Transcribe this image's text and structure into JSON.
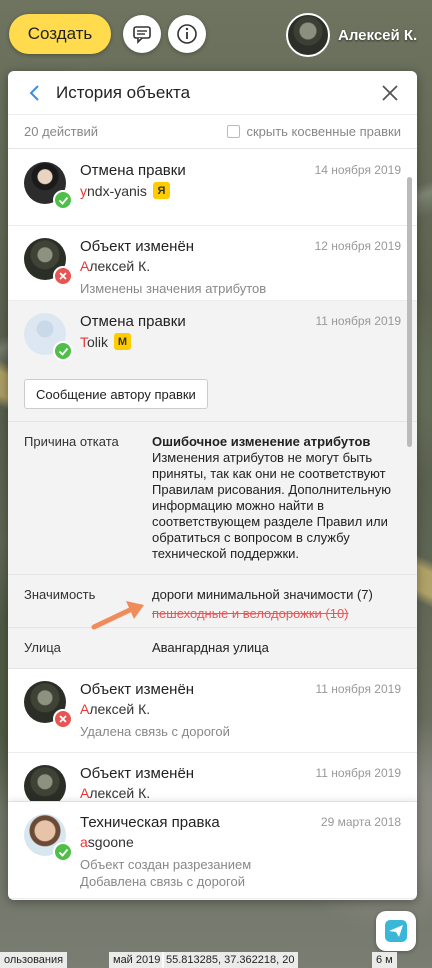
{
  "toolbar": {
    "create_label": "Создать",
    "user_name": "Алексей К."
  },
  "panel": {
    "title": "История объекта",
    "count": "20 действий",
    "hide_indirect": "скрыть косвенные правки"
  },
  "items": [
    {
      "title": "Отмена правки",
      "date": "14 ноября 2019",
      "user_first": "y",
      "user_rest": "ndx-yanis",
      "rank": "Я",
      "status": "ok",
      "note": ""
    },
    {
      "title": "Объект изменён",
      "date": "12 ноября 2019",
      "user_first": "А",
      "user_rest": "лексей К.",
      "status": "bad",
      "note": "Изменены значения атрибутов"
    },
    {
      "title": "Отмена правки",
      "date": "11 ноября 2019",
      "user_first": "T",
      "user_rest": "olik",
      "rank": "М",
      "status": "ok",
      "note": ""
    },
    {
      "title": "Объект изменён",
      "date": "11 ноября 2019",
      "user_first": "А",
      "user_rest": "лексей К.",
      "status": "bad",
      "note": "Удалена связь с дорогой"
    },
    {
      "title": "Объект изменён",
      "date": "11 ноября 2019",
      "user_first": "А",
      "user_rest": "лексей К.",
      "status": "bad",
      "note": ""
    },
    {
      "title": "Техническая правка",
      "date": "29 марта 2018",
      "user_first": "a",
      "user_rest": "sgoone",
      "status": "ok",
      "note": "Объект создан разрезанием",
      "note2": "Добавлена связь с дорогой"
    }
  ],
  "details": {
    "message_button": "Сообщение автору правки",
    "reason_label": "Причина отката",
    "reason_title": "Ошибочное изменение атрибутов",
    "reason_text": "Изменения атрибутов не могут быть приняты, так как они не соответствуют Правилам рисования. Дополнительную информацию можно найти в соответствующем разделе Правил или обратиться с вопросом в службу технической поддержки.",
    "importance_label": "Значимость",
    "importance_new": "дороги минимальной значимости (7)",
    "importance_old": "пешеходные и велодорожки (10)",
    "street_label": "Улица",
    "street_value": "Авангардная улица"
  },
  "statusbar": {
    "left": "ользования",
    "date": "май 2019",
    "coords": "55.813285, 37.362218, 20",
    "scale": "6 м"
  },
  "colors": {
    "accent": "#ffdb4d",
    "link": "#3a8ee6",
    "ok": "#4fbf4a",
    "bad": "#e85454"
  }
}
